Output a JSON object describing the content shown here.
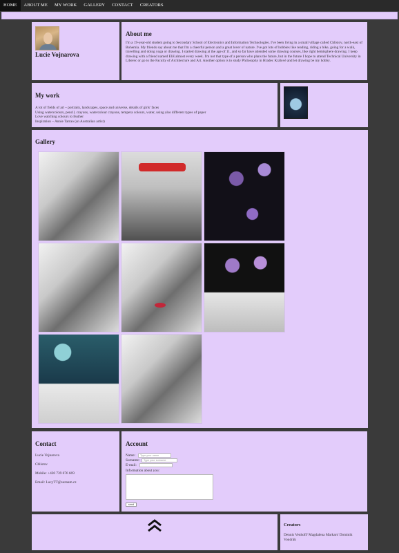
{
  "nav": {
    "items": [
      {
        "label": "HOME"
      },
      {
        "label": "ABOUT ME"
      },
      {
        "label": "MY WORK"
      },
      {
        "label": "GALLERY"
      },
      {
        "label": "CONTACT"
      },
      {
        "label": "CREATORS"
      }
    ],
    "active": "HOME"
  },
  "profile": {
    "name": "Lucie Vojnarova"
  },
  "about": {
    "title": "About me",
    "text": "I'm a 19-year-old student going to Secondary School of Electronics and Information Technologies. I've been living in a small village called Chlistov, north-east of Bohemia. My friends say about me that I'm a cheerful person and a great lover of nature. I've got lots of hobbies like reading, riding a bike, going for a walk, travelling and doing yoga or drawing. I started drawing at the age of 11, and so far have attended some drawing courses, like right hemisphere drawing. I keep drawing with a friend named Eliš almost every week. I'm not that type of a person who plans the future, but in the future I hope to attend Technical University in Liberec or go to the Faculty of Architecture and Art. Another option is to study Philosophy in Hradec Králové and let drawing be my hobby."
  },
  "mywork": {
    "title": "My work",
    "lines": [
      "A lot of fields of art – portraits, landscapes, space and universe, details of girls' faces",
      "Using watercolours, pencil, crayons, watercolour crayons, tempera colours, water, using also different types of paper",
      "Love watching colours to feather",
      "Inspiration – Annie Tarrao (an Australian artist)"
    ]
  },
  "gallery": {
    "title": "Gallery"
  },
  "contact": {
    "title": "Contact",
    "name": "Lucie Vojnarova",
    "city": "Chlistov",
    "mobile": "Mobile: +420 739 676 669",
    "email": "Email: LucyTT@seznam.cz"
  },
  "account": {
    "title": "Account",
    "name_label": "Name:",
    "name_placeholder": "Type your name",
    "surname_label": "Surname:",
    "surname_placeholder": "Type your surname",
    "email_label": "E-mail:",
    "info_label": "Information about you:",
    "send_label": "send"
  },
  "creators": {
    "title": "Creators",
    "text": "Dennis Venhoff/ Magdalena Markart/ Dominik Vondrák"
  },
  "icons": {
    "scroll_up": "double-chevron-up-icon"
  }
}
